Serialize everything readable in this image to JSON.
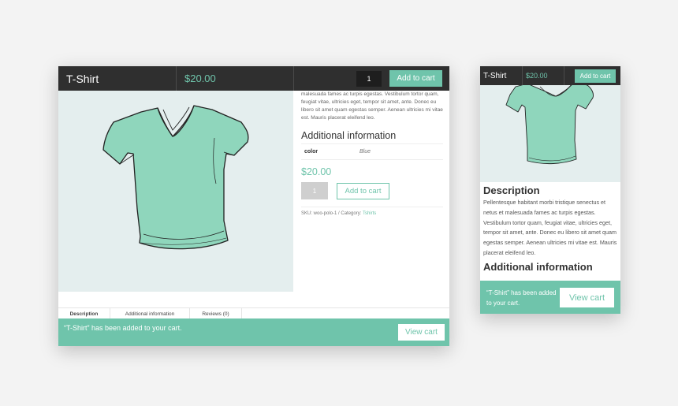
{
  "colors": {
    "accent": "#6fc4ab",
    "sticky_bg": "#2f2f2f",
    "image_bg": "#e4eeee"
  },
  "desktop": {
    "sticky": {
      "title": "T-Shirt",
      "price": "$20.00",
      "qty": "1",
      "add_label": "Add to cart"
    },
    "summary_text": "malesuada fames ac turpis egestas. Vestibulum tortor quam, feugiat vitae, ultricies eget, tempor sit amet, ante. Donec eu libero sit amet quam egestas semper. Aenean ultricies mi vitae est. Mauris placerat eleifend leo.",
    "additional_heading": "Additional information",
    "attr": {
      "key": "color",
      "value": "Blue"
    },
    "price": "$20.00",
    "qty": "1",
    "add_label": "Add to cart",
    "meta": {
      "sku": "SKU: woo-polo-1 / Category:",
      "category": "Tshirts"
    },
    "tabs": [
      "Description",
      "Additional information",
      "Reviews (0)"
    ],
    "notice": {
      "text": "“T-Shirt” has been added to your cart.",
      "button": "View cart"
    },
    "icons": [
      "tshirt-image-icon"
    ]
  },
  "mobile": {
    "sticky": {
      "title": "T-Shirt",
      "price": "$20.00",
      "add_label": "Add to cart"
    },
    "description_heading": "Description",
    "description_text": "Pellentesque habitant morbi tristique senectus et netus et malesuada fames ac turpis egestas. Vestibulum tortor quam, feugiat vitae, ultricies eget, tempor sit amet, ante. Donec eu libero sit amet quam egestas semper. Aenean ultricies mi vitae est. Mauris placerat eleifend leo.",
    "additional_heading": "Additional information",
    "notice": {
      "text": "“T-Shirt” has been added to your cart.",
      "button": "View cart"
    }
  }
}
